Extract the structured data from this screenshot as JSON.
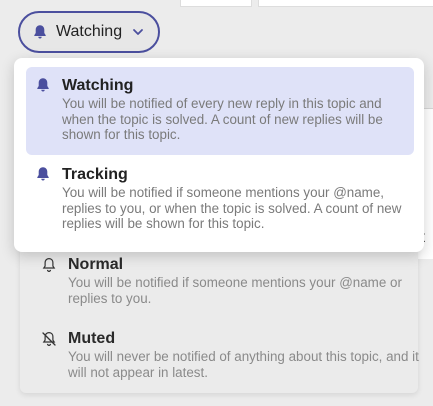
{
  "trigger": {
    "label": "Watching",
    "bell_icon": "bell-icon",
    "chevron_icon": "chevron-down-icon"
  },
  "background": {
    "partial_text": "it"
  },
  "options": [
    {
      "title": "Watching",
      "description": "You will be notified of every new reply in this topic and when the topic is solved. A count of new replies will be shown for this topic.",
      "icon": "bell-filled-icon",
      "selected": true
    },
    {
      "title": "Tracking",
      "description": "You will be notified if someone mentions your @name, replies to you, or when the topic is solved. A count of new replies will be shown for this topic.",
      "icon": "bell-filled-icon",
      "selected": false
    },
    {
      "title": "Normal",
      "description": "You will be notified if someone mentions your @name or replies to you.",
      "icon": "bell-outline-icon",
      "selected": false
    },
    {
      "title": "Muted",
      "description": "You will never be notified of anything about this topic, and it will not appear in latest.",
      "icon": "bell-slash-icon",
      "selected": false
    }
  ],
  "colors": {
    "accent": "#4b4f9e",
    "selected_bg": "#dfe2f8",
    "description": "#7a7a7a"
  }
}
